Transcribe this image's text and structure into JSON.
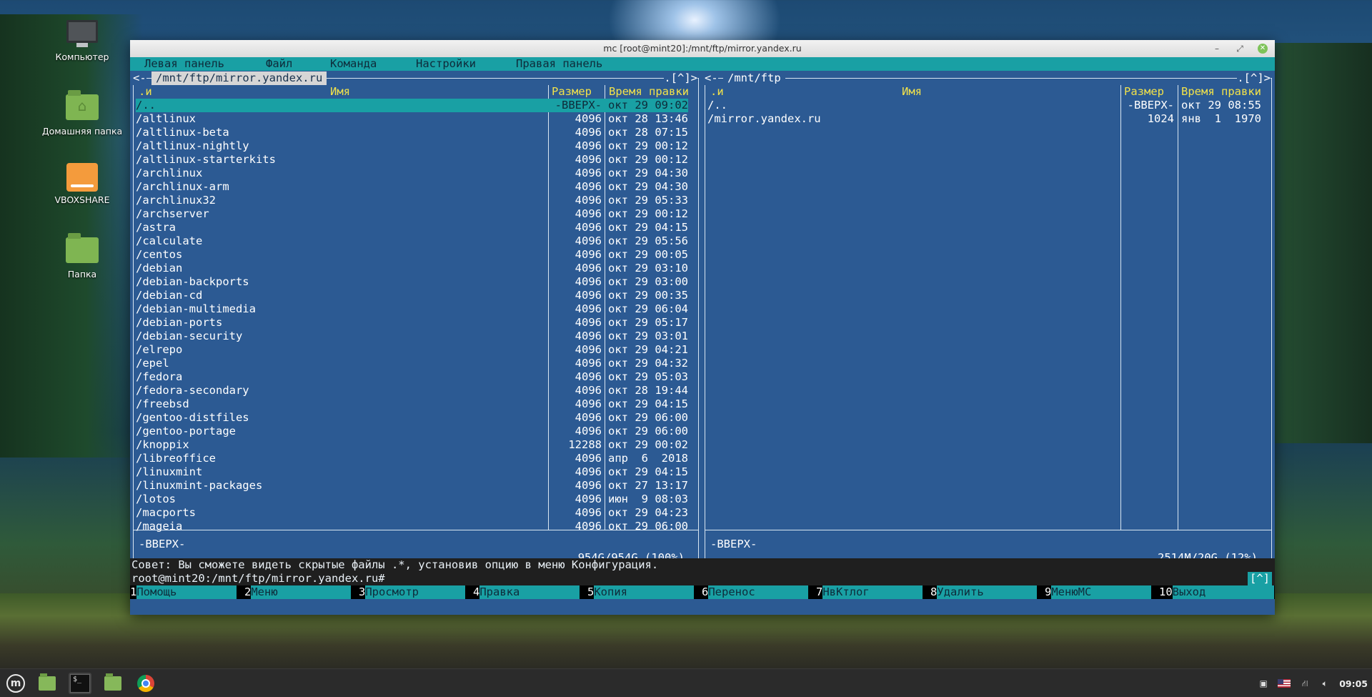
{
  "desktop": {
    "icons": [
      {
        "label": "Компьютер"
      },
      {
        "label": "Домашняя папка"
      },
      {
        "label": "VBOXSHARE"
      },
      {
        "label": "Папка"
      }
    ]
  },
  "window": {
    "title": "mc [root@mint20]:/mnt/ftp/mirror.yandex.ru",
    "minimize": "–",
    "maximize": "⤢",
    "close": "✕"
  },
  "menubar": [
    "Левая панель",
    "Файл",
    "Команда",
    "Настройки",
    "Правая панель"
  ],
  "left_panel": {
    "path": "/mnt/ftp/mirror.yandex.ru",
    "corner_left": "<-",
    "corner_right": ".[^]>",
    "headers": {
      "name_prefix": ".и",
      "name": "Имя",
      "size": "Размер",
      "mtime": "Время правки"
    },
    "rows": [
      {
        "name": "/..",
        "size": "-ВВЕРХ-",
        "mtime": "окт 29 09:02",
        "selected": true
      },
      {
        "name": "/altlinux",
        "size": "4096",
        "mtime": "окт 28 13:46"
      },
      {
        "name": "/altlinux-beta",
        "size": "4096",
        "mtime": "окт 28 07:15"
      },
      {
        "name": "/altlinux-nightly",
        "size": "4096",
        "mtime": "окт 29 00:12"
      },
      {
        "name": "/altlinux-starterkits",
        "size": "4096",
        "mtime": "окт 29 00:12"
      },
      {
        "name": "/archlinux",
        "size": "4096",
        "mtime": "окт 29 04:30"
      },
      {
        "name": "/archlinux-arm",
        "size": "4096",
        "mtime": "окт 29 04:30"
      },
      {
        "name": "/archlinux32",
        "size": "4096",
        "mtime": "окт 29 05:33"
      },
      {
        "name": "/archserver",
        "size": "4096",
        "mtime": "окт 29 00:12"
      },
      {
        "name": "/astra",
        "size": "4096",
        "mtime": "окт 29 04:15"
      },
      {
        "name": "/calculate",
        "size": "4096",
        "mtime": "окт 29 05:56"
      },
      {
        "name": "/centos",
        "size": "4096",
        "mtime": "окт 29 00:05"
      },
      {
        "name": "/debian",
        "size": "4096",
        "mtime": "окт 29 03:10"
      },
      {
        "name": "/debian-backports",
        "size": "4096",
        "mtime": "окт 29 03:00"
      },
      {
        "name": "/debian-cd",
        "size": "4096",
        "mtime": "окт 29 00:35"
      },
      {
        "name": "/debian-multimedia",
        "size": "4096",
        "mtime": "окт 29 06:04"
      },
      {
        "name": "/debian-ports",
        "size": "4096",
        "mtime": "окт 29 05:17"
      },
      {
        "name": "/debian-security",
        "size": "4096",
        "mtime": "окт 29 03:01"
      },
      {
        "name": "/elrepo",
        "size": "4096",
        "mtime": "окт 29 04:21"
      },
      {
        "name": "/epel",
        "size": "4096",
        "mtime": "окт 29 04:32"
      },
      {
        "name": "/fedora",
        "size": "4096",
        "mtime": "окт 29 05:03"
      },
      {
        "name": "/fedora-secondary",
        "size": "4096",
        "mtime": "окт 28 19:44"
      },
      {
        "name": "/freebsd",
        "size": "4096",
        "mtime": "окт 29 04:15"
      },
      {
        "name": "/gentoo-distfiles",
        "size": "4096",
        "mtime": "окт 29 06:00"
      },
      {
        "name": "/gentoo-portage",
        "size": "4096",
        "mtime": "окт 29 06:00"
      },
      {
        "name": "/knoppix",
        "size": "12288",
        "mtime": "окт 29 00:02"
      },
      {
        "name": "/libreoffice",
        "size": "4096",
        "mtime": "апр  6  2018"
      },
      {
        "name": "/linuxmint",
        "size": "4096",
        "mtime": "окт 29 04:15"
      },
      {
        "name": "/linuxmint-packages",
        "size": "4096",
        "mtime": "окт 27 13:17"
      },
      {
        "name": "/lotos",
        "size": "4096",
        "mtime": "июн  9 08:03"
      },
      {
        "name": "/macports",
        "size": "4096",
        "mtime": "окт 29 04:23"
      },
      {
        "name": "/mageia",
        "size": "4096",
        "mtime": "окт 29 06:00"
      }
    ],
    "status": "-ВВЕРХ-",
    "disk_info": "954G/954G (100%)"
  },
  "right_panel": {
    "path": "/mnt/ftp",
    "corner_left": "<-",
    "corner_right": ".[^]>",
    "headers": {
      "name_prefix": ".и",
      "name": "Имя",
      "size": "Размер",
      "mtime": "Время правки"
    },
    "rows": [
      {
        "name": "/..",
        "size": "-ВВЕРХ-",
        "mtime": "окт 29 08:55"
      },
      {
        "name": "/mirror.yandex.ru",
        "size": "1024",
        "mtime": "янв  1  1970"
      }
    ],
    "status": "-ВВЕРХ-",
    "disk_info": "2514M/20G (12%)"
  },
  "hint": "Совет: Вы сможете видеть скрытые файлы .*, установив опцию в меню Конфигурация.",
  "prompt": "root@mint20:/mnt/ftp/mirror.yandex.ru# ",
  "prompt_indicator": "[^]",
  "fkeys": [
    {
      "num": "1",
      "label": "Помощь"
    },
    {
      "num": "2",
      "label": "Меню"
    },
    {
      "num": "3",
      "label": "Просмотр"
    },
    {
      "num": "4",
      "label": "Правка"
    },
    {
      "num": "5",
      "label": "Копия"
    },
    {
      "num": "6",
      "label": "Перенос"
    },
    {
      "num": "7",
      "label": "НвКтлог"
    },
    {
      "num": "8",
      "label": "Удалить"
    },
    {
      "num": "9",
      "label": "МенюМС"
    },
    {
      "num": "10",
      "label": "Выход"
    }
  ],
  "taskbar": {
    "clock": "09:05",
    "items": [
      "mint-menu-icon",
      "files-icon",
      "terminal-icon",
      "folder-icon",
      "chrome-icon"
    ]
  },
  "colors": {
    "panel_bg": "#2c5a93",
    "accent": "#19a0a4",
    "header_text": "#f2e24a"
  }
}
